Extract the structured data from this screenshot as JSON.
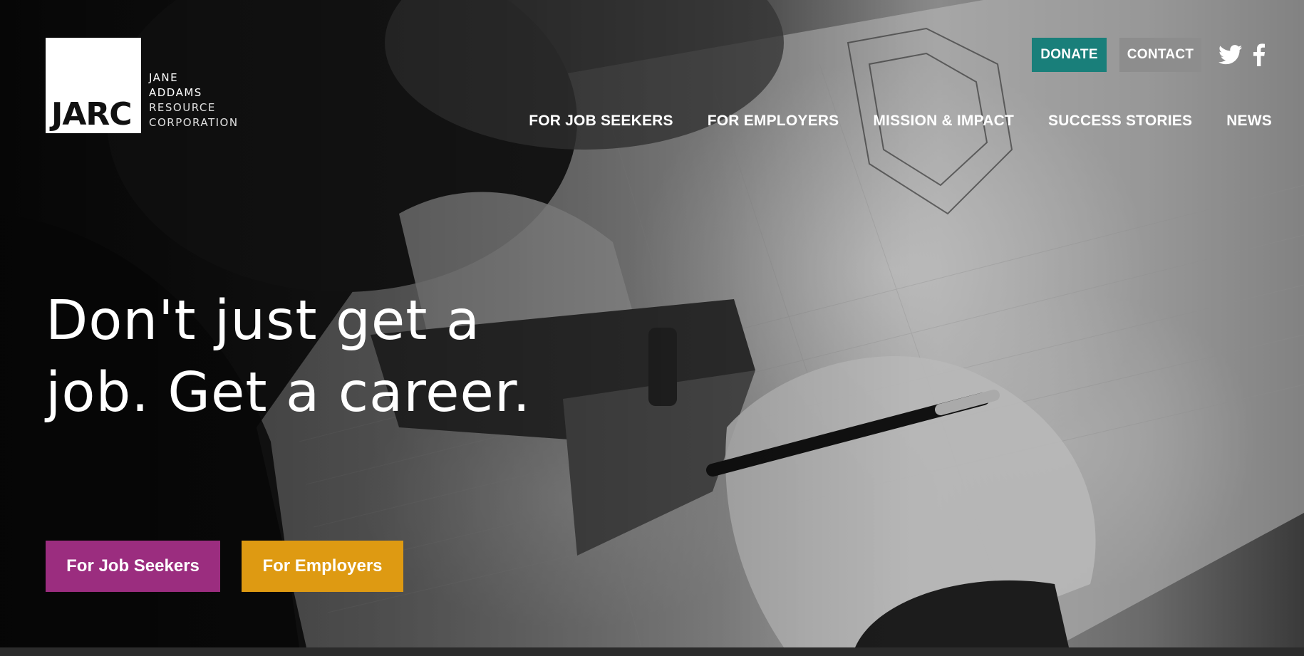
{
  "logo": {
    "mark": "JARC",
    "lines": [
      "JANE",
      "ADDAMS",
      "RESOURCE",
      "CORPORATION"
    ]
  },
  "top_actions": {
    "donate_label": "DONATE",
    "contact_label": "CONTACT"
  },
  "social": {
    "twitter_icon": "twitter-icon",
    "facebook_icon": "facebook-icon"
  },
  "nav": {
    "items": [
      {
        "label": "FOR JOB SEEKERS"
      },
      {
        "label": "FOR EMPLOYERS"
      },
      {
        "label": "MISSION & IMPACT"
      },
      {
        "label": "SUCCESS STORIES"
      },
      {
        "label": "NEWS"
      }
    ]
  },
  "hero": {
    "headline_line1": "Don't just get a",
    "headline_line2": "job. Get a career."
  },
  "cta": {
    "job_seekers_label": "For Job Seekers",
    "employers_label": "For Employers"
  },
  "colors": {
    "donate": "#197f7a",
    "contact": "#8d8d8d",
    "job_seekers": "#9b2d7f",
    "employers": "#de9a12"
  }
}
